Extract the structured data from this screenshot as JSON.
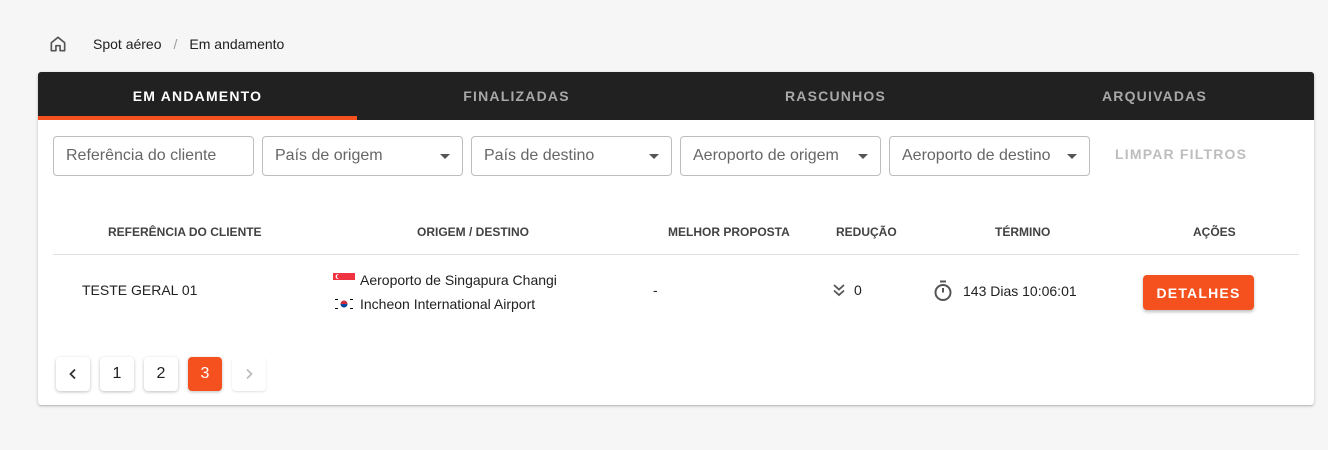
{
  "breadcrumb": {
    "home_icon": "home-icon",
    "items": [
      "Spot aéreo",
      "Em andamento"
    ],
    "separator": "/"
  },
  "tabs": [
    {
      "label": "EM ANDAMENTO",
      "active": true
    },
    {
      "label": "FINALIZADAS",
      "active": false
    },
    {
      "label": "RASCUNHOS",
      "active": false
    },
    {
      "label": "ARQUIVADAS",
      "active": false
    }
  ],
  "filters": {
    "client_ref_placeholder": "Referência do cliente",
    "origin_country": "País de origem",
    "dest_country": "País de destino",
    "origin_airport": "Aeroporto de origem",
    "dest_airport": "Aeroporto de destino",
    "clear_label": "LIMPAR FILTROS"
  },
  "table": {
    "headers": [
      "REFERÊNCIA DO CLIENTE",
      "ORIGEM / DESTINO",
      "MELHOR PROPOSTA",
      "REDUÇÃO",
      "TÉRMINO",
      "AÇÕES"
    ],
    "rows": [
      {
        "reference": "TESTE GERAL 01",
        "origin": "Aeroporto de Singapura Changi",
        "destination": "Incheon International Airport",
        "best_offer": "-",
        "reduction": "0",
        "end": "143 Dias 10:06:01",
        "action_label": "DETALHES"
      }
    ]
  },
  "pagination": {
    "pages": [
      "1",
      "2",
      "3"
    ],
    "current": "3",
    "prev_icon": "chevron-left-icon",
    "next_icon": "chevron-right-icon"
  },
  "colors": {
    "accent": "#f4511e",
    "tab_bar": "#212121"
  }
}
